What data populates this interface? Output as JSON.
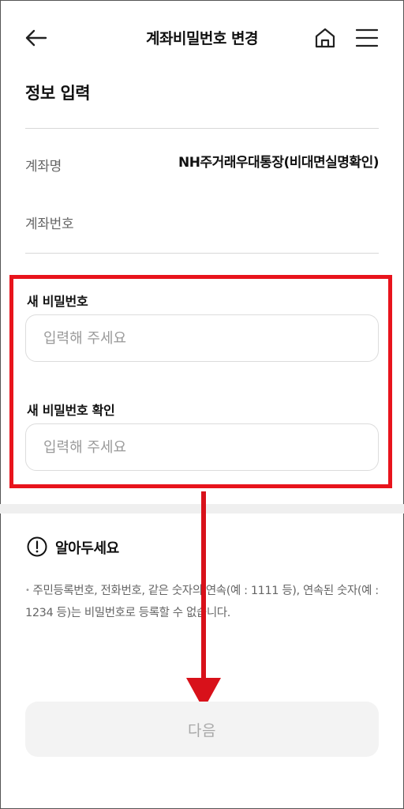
{
  "header": {
    "title": "계좌비밀번호 변경",
    "back_icon": "arrow-left-icon",
    "home_icon": "home-icon",
    "menu_icon": "hamburger-menu-icon"
  },
  "info_section": {
    "title": "정보 입력",
    "account_name_label": "계좌명",
    "account_name_value": "NH주거래우대통장(비대면실명확인)",
    "account_number_label": "계좌번호",
    "account_number_value": ""
  },
  "form": {
    "new_password_label": "새 비밀번호",
    "new_password_placeholder": "입력해 주세요",
    "confirm_password_label": "새 비밀번호 확인",
    "confirm_password_placeholder": "입력해 주세요"
  },
  "notice": {
    "icon": "exclamation-circle-icon",
    "title": "알아두세요",
    "text": "주민등록번호, 전화번호, 같은 숫자의 연속(예 : 1111 등), 연속된 숫자(예 : 1234 등)는 비밀번호로 등록할 수 없습니다."
  },
  "footer": {
    "next_label": "다음"
  },
  "annotation": {
    "highlight_color": "#e8141c"
  }
}
